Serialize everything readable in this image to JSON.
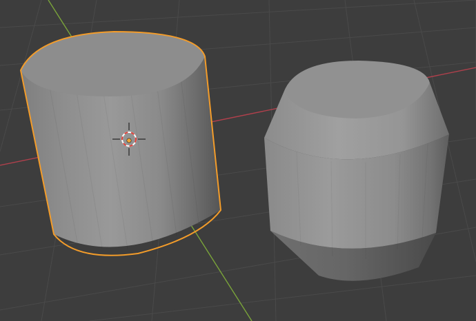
{
  "app": "3D Viewport",
  "colors": {
    "background": "#3d3d3d",
    "grid_line": "#4a4a4a",
    "x_axis": "#b1404c",
    "y_axis": "#7aa43a",
    "selection_outline": "#f39c2a",
    "cursor_red": "#e0413a",
    "cursor_white": "#ffffff",
    "origin_dot": "#f3a534"
  },
  "objects": [
    {
      "label": "cylinder",
      "selected": true,
      "shape": "cylinder"
    },
    {
      "label": "beveled-cylinder",
      "selected": false,
      "shape": "beveled-cylinder"
    }
  ],
  "icons": [
    "3d-cursor-icon",
    "object-origin-icon"
  ]
}
